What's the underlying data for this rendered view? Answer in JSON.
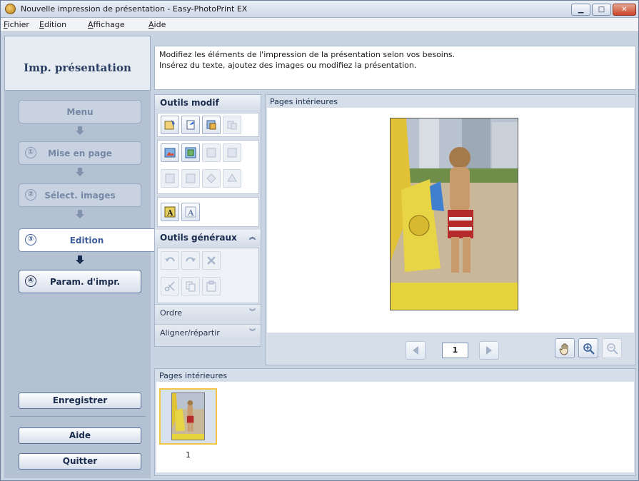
{
  "window": {
    "title": "Nouvelle impression de présentation - Easy-PhotoPrint EX",
    "controls": {
      "minimize_icon": "minimize-icon",
      "maximize_icon": "maximize-icon",
      "close_icon": "close-icon"
    }
  },
  "menu": {
    "items": [
      "Fichier",
      "Edition",
      "Affichage",
      "Aide"
    ]
  },
  "sidebar": {
    "header": "Imp. présentation",
    "steps": [
      {
        "label": "Menu",
        "number": "",
        "state": "disabled"
      },
      {
        "label": "Mise en page",
        "number": "①",
        "state": "disabled"
      },
      {
        "label": "Sélect. images",
        "number": "②",
        "state": "disabled"
      },
      {
        "label": "Edition",
        "number": "③",
        "state": "active"
      },
      {
        "label": "Param. d'impr.",
        "number": "④",
        "state": "enabled"
      }
    ],
    "save_label": "Enregistrer",
    "help_label": "Aide",
    "quit_label": "Quitter"
  },
  "instructions": {
    "line1": "Modifiez les éléments de l'impression de la présentation selon vos besoins.",
    "line2": "Insérez du texte, ajoutez des images ou modifiez la présentation."
  },
  "tools": {
    "edit_title": "Outils modif",
    "general_title": "Outils généraux",
    "order_label": "Ordre",
    "align_label": "Aligner/répartir"
  },
  "preview": {
    "caption": "Pages intérieures",
    "page_number": "1"
  },
  "thumbnails": {
    "caption": "Pages intérieures",
    "items": [
      {
        "label": "1"
      }
    ]
  },
  "colors": {
    "accent": "#3e5f9c",
    "panel": "#d6deea",
    "sidebar": "#b4c1d3",
    "selection": "#f3c64a"
  }
}
